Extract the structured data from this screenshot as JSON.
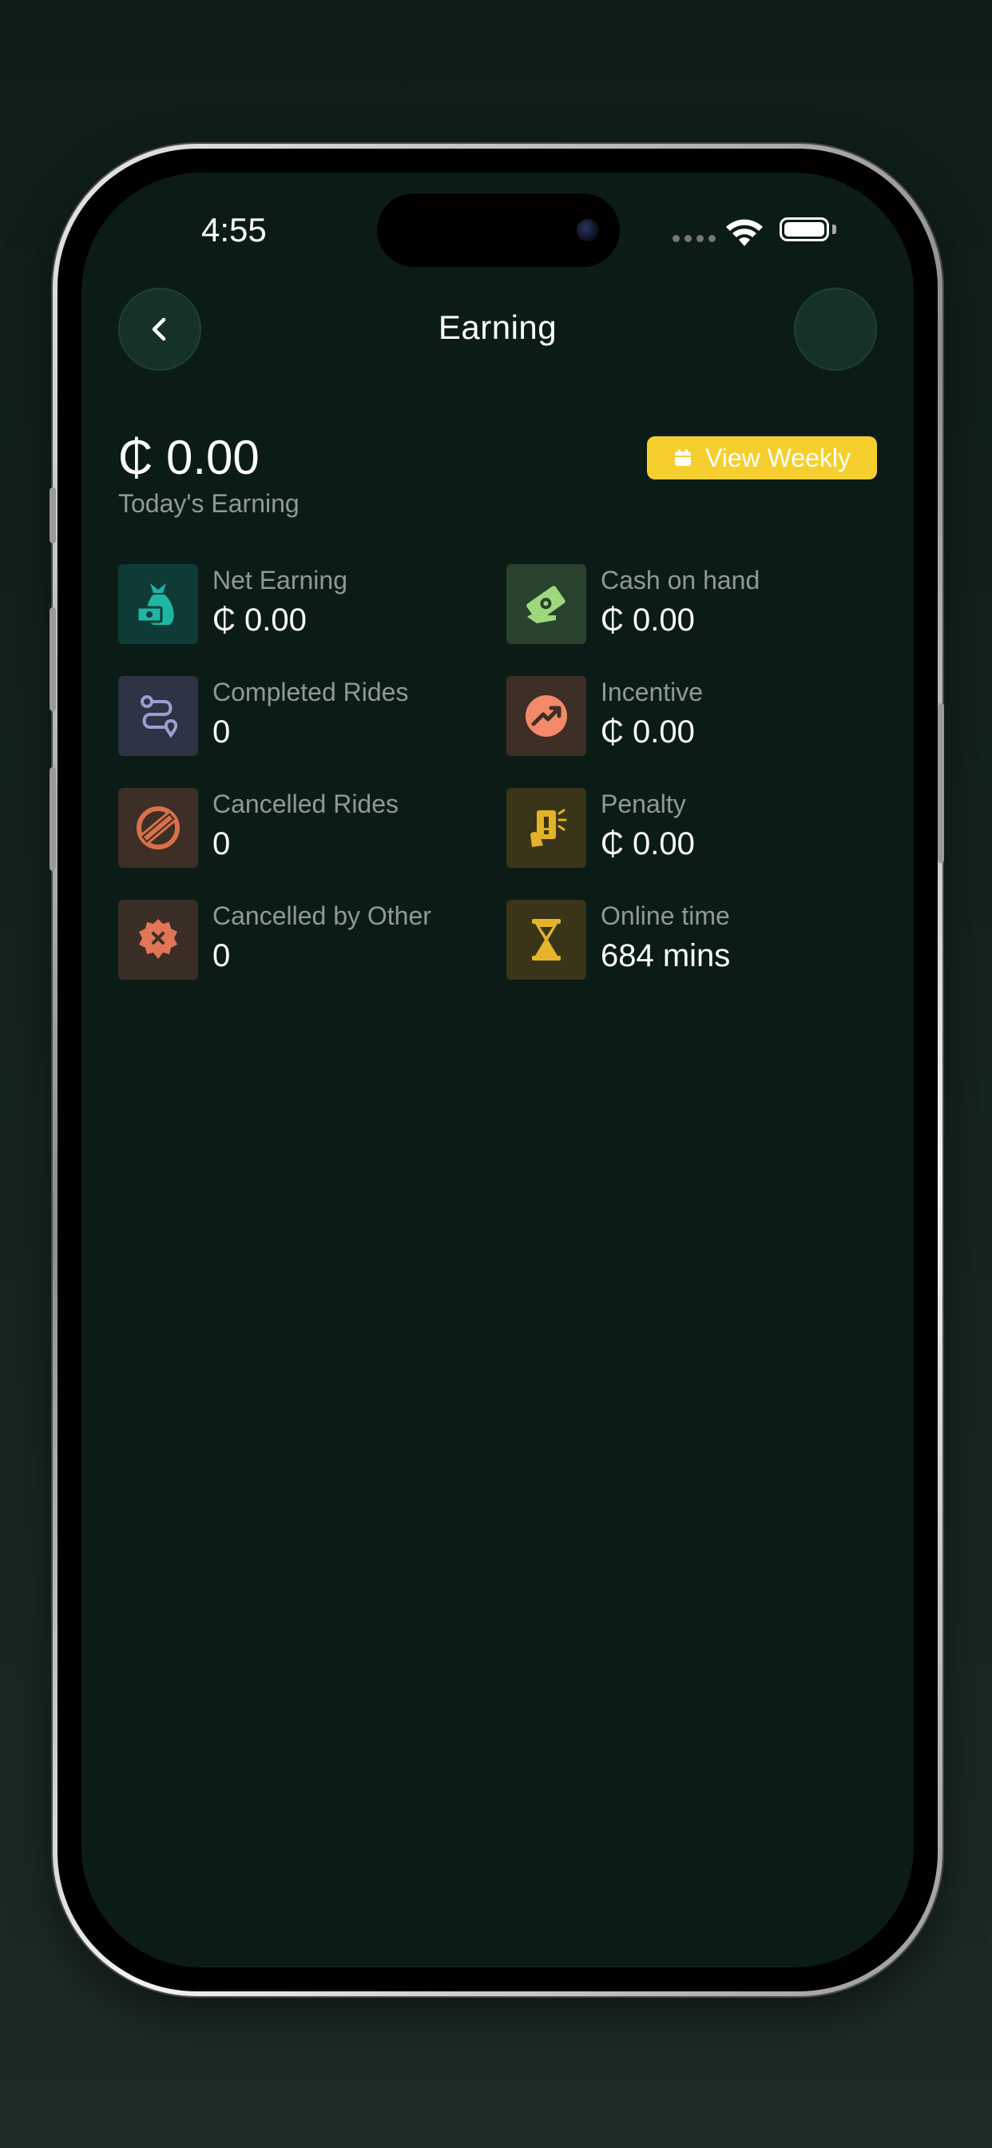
{
  "status_bar": {
    "time": "4:55"
  },
  "header": {
    "title": "Earning"
  },
  "summary": {
    "amount": "₵ 0.00",
    "label": "Today's Earning",
    "view_weekly_label": "View Weekly"
  },
  "stats": [
    {
      "label": "Net Earning",
      "value": "₵ 0.00",
      "icon": "money-bag-icon",
      "color": "#1fb5a5"
    },
    {
      "label": "Cash on hand",
      "value": "₵ 0.00",
      "icon": "cash-hand-icon",
      "color": "#9ed87a"
    },
    {
      "label": "Completed Rides",
      "value": "0",
      "icon": "route-icon",
      "color": "#9b9fd0"
    },
    {
      "label": "Incentive",
      "value": "₵ 0.00",
      "icon": "trend-up-icon",
      "color": "#f4896a"
    },
    {
      "label": "Cancelled Rides",
      "value": "0",
      "icon": "cancelled-stamp-icon",
      "color": "#d9704a"
    },
    {
      "label": "Penalty",
      "value": "₵ 0.00",
      "icon": "penalty-card-icon",
      "color": "#e2b227"
    },
    {
      "label": "Cancelled by Other",
      "value": "0",
      "icon": "cancel-badge-icon",
      "color": "#e07655"
    },
    {
      "label": "Online time",
      "value": "684 mins",
      "icon": "hourglass-icon",
      "color": "#e4b52a"
    }
  ],
  "colors": {
    "background": "#0b1c16",
    "accent_yellow": "#f6cf2e",
    "muted_text": "#8e9a95"
  }
}
